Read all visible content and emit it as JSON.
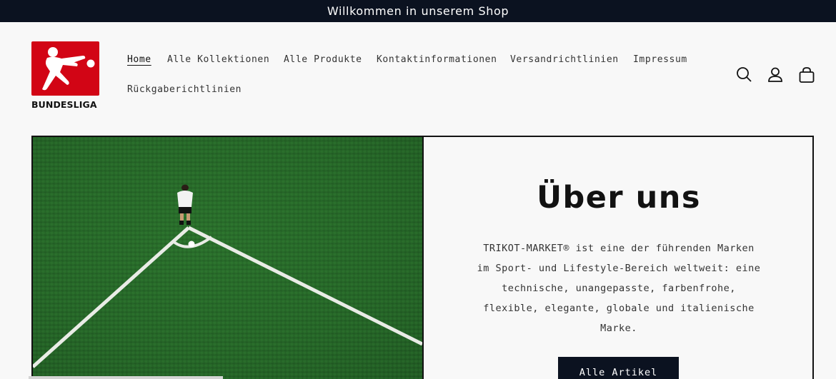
{
  "announcement": {
    "text": "Willkommen in unserem Shop"
  },
  "brand": {
    "wordmark": "BUNDESLIGA",
    "logo_color": "#d20515"
  },
  "nav": {
    "items": [
      {
        "label": "Home",
        "active": true
      },
      {
        "label": "Alle Kollektionen"
      },
      {
        "label": "Alle Produkte"
      },
      {
        "label": "Kontaktinformationen"
      },
      {
        "label": "Versandrichtlinien"
      },
      {
        "label": "Impressum"
      },
      {
        "label": "Rückgaberichtlinien"
      }
    ]
  },
  "header_icons": [
    "search-icon",
    "account-icon",
    "cart-icon"
  ],
  "hero": {
    "title": "Über uns",
    "body": "TRIKOT-MARKET® ist eine der führenden Marken im Sport- und Lifestyle-Bereich weltweit: eine technische, unangepasste, farbenfrohe, flexible, elegante, globale und italienische Marke.",
    "button_label": "Alle Artikel"
  },
  "colors": {
    "dark": "#0b1220",
    "background": "#f8f8f8",
    "grass": "#2a6a2c"
  }
}
